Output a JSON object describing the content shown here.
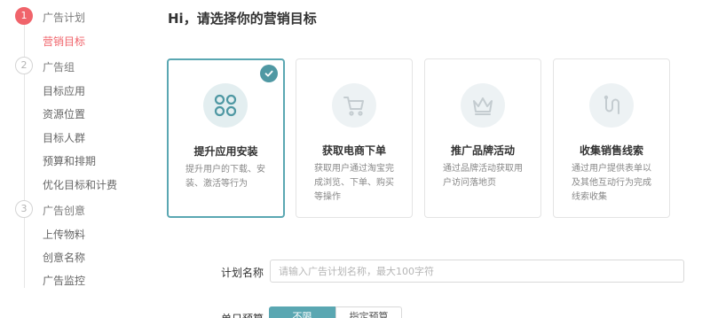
{
  "sidebar": {
    "steps": [
      {
        "number": "1",
        "label": "广告计划"
      },
      {
        "number": "2",
        "label": "广告组"
      },
      {
        "number": "3",
        "label": "广告创意"
      }
    ],
    "items": [
      {
        "label": "营销目标"
      },
      {
        "label": "目标应用"
      },
      {
        "label": "资源位置"
      },
      {
        "label": "目标人群"
      },
      {
        "label": "预算和排期"
      },
      {
        "label": "优化目标和计费"
      },
      {
        "label": "上传物料"
      },
      {
        "label": "创意名称"
      },
      {
        "label": "广告监控"
      }
    ]
  },
  "main": {
    "title": "Hi，请选择你的营销目标",
    "cards": [
      {
        "title": "提升应用安装",
        "desc": "提升用户的下载、安装、激活等行为",
        "icon": "app-grid-icon",
        "selected": true
      },
      {
        "title": "获取电商下单",
        "desc": "获取用户通过淘宝完成浏览、下单、购买等操作",
        "icon": "shopping-cart-icon",
        "selected": false
      },
      {
        "title": "推广品牌活动",
        "desc": "通过品牌活动获取用户访问落地页",
        "icon": "crown-icon",
        "selected": false
      },
      {
        "title": "收集销售线索",
        "desc": "通过用户提供表单以及其他互动行为完成线索收集",
        "icon": "path-icon",
        "selected": false
      }
    ],
    "form": {
      "name_label": "计划名称",
      "name_placeholder": "请输入广告计划名称，最大100字符",
      "name_value": "",
      "budget_label": "单日预算",
      "budget_options": [
        "不限",
        "指定预算"
      ],
      "budget_selected": "不限"
    }
  },
  "colors": {
    "accent": "#5aa7b2",
    "active_step": "#f0646b",
    "icon_bg": "#edf2f4"
  }
}
